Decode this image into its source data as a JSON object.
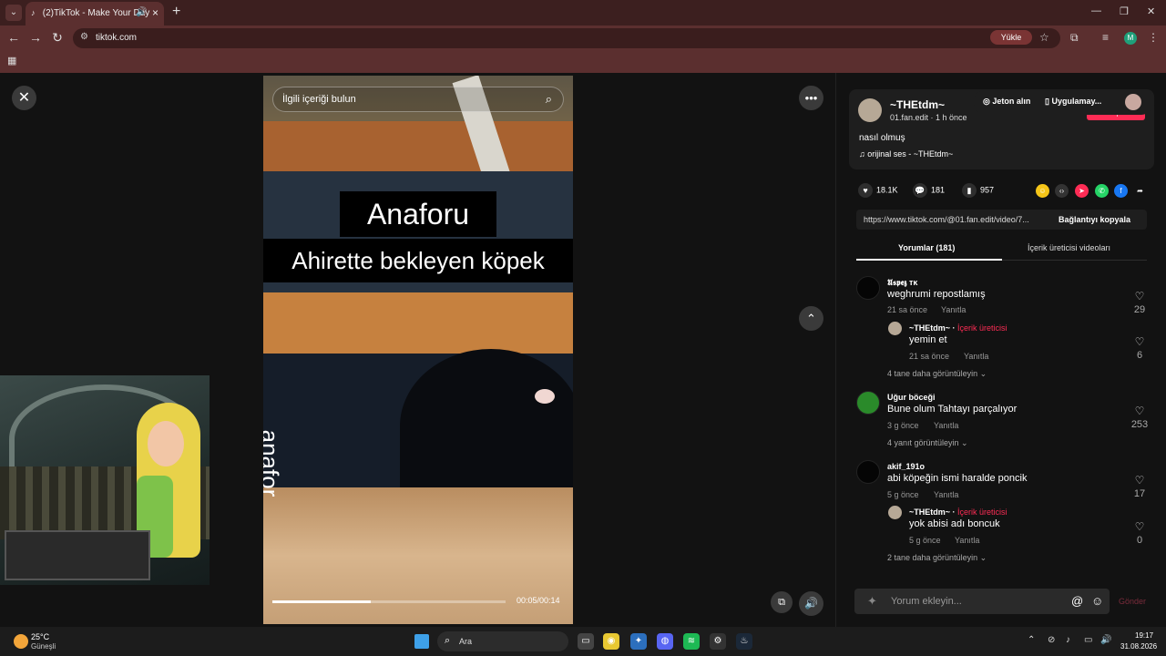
{
  "browser": {
    "tab_title": "(2)TikTok - Make Your Day",
    "url": "tiktok.com",
    "install_label": "Yükle",
    "profile_initial": "M"
  },
  "video": {
    "search_placeholder": "İlgili içeriği bulun",
    "caption_line1": "Anaforu",
    "caption_line2": "Ahirette bekleyen köpek",
    "caption_vertical": "anafor",
    "time": "00:05/00:14",
    "progress": 0.42
  },
  "post": {
    "username": "~THEtdm~",
    "meta": "01.fan.edit · 1 h önce",
    "follow_label": "Takip et",
    "description": "nasıl olmuş",
    "music": "orijinal ses - ~THEtdm~",
    "top_pills": {
      "coins": "Jeton alın",
      "app": "Uygulamay..."
    },
    "likes": "18.1K",
    "comments": "181",
    "saves": "957",
    "link": "https://www.tiktok.com/@01.fan.edit/video/7...",
    "copy_label": "Bağlantıyı kopyala"
  },
  "tabs": {
    "comments": "Yorumlar (181)",
    "creator_videos": "İçerik üreticisi videoları"
  },
  "comments": [
    {
      "user": "𝖀𝖘𝖕𝖊𝖟 ᴛᴋ",
      "text": "weghrumi repostlamış",
      "time": "21 sa önce",
      "reply": "Yanıtla",
      "likes": "29"
    },
    {
      "user": "~THEtdm~ · ",
      "creator": "İçerik üreticisi",
      "text": "yemin et",
      "time": "21 sa önce",
      "reply": "Yanıtla",
      "likes": "6",
      "more": "4 tane daha görüntüleyin ⌄"
    },
    {
      "user": "Uğur böceği",
      "text": "Bune olum Tahtayı parçalıyor",
      "time": "3 g önce",
      "reply": "Yanıtla",
      "likes": "253",
      "more": "4 yanıt görüntüleyin ⌄"
    },
    {
      "user": "akif_191o",
      "text": "abi köpeğin ismi haralde poncik",
      "time": "5 g önce",
      "reply": "Yanıtla",
      "likes": "17"
    },
    {
      "user": "~THEtdm~ · ",
      "creator": "İçerik üreticisi",
      "text": "yok abisi adı boncuk",
      "time": "5 g önce",
      "reply": "Yanıtla",
      "likes": "0",
      "more": "2 tane daha görüntüleyin ⌄"
    }
  ],
  "comment_input": {
    "placeholder": "Yorum ekleyin...",
    "send_label": "Gönder"
  },
  "taskbar": {
    "temp": "25°C",
    "weather": "Güneşli",
    "search_label": "Ara",
    "time": "19:17",
    "date": "31.08.2026"
  }
}
